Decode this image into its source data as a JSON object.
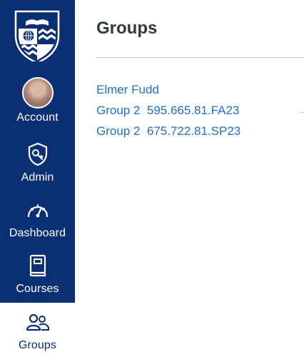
{
  "sidebar": {
    "items": [
      {
        "label": "Account",
        "icon": "avatar"
      },
      {
        "label": "Admin",
        "icon": "shield-key-icon"
      },
      {
        "label": "Dashboard",
        "icon": "speedometer-icon"
      },
      {
        "label": "Courses",
        "icon": "book-icon"
      },
      {
        "label": "Groups",
        "icon": "users-icon",
        "active": true
      }
    ]
  },
  "main": {
    "title": "Groups",
    "groups": [
      {
        "label": "Elmer Fudd"
      },
      {
        "label": "Group 2  595.665.81.FA23"
      },
      {
        "label": "Group 2  675.722.81.SP23"
      }
    ]
  },
  "colors": {
    "sidebar_bg": "#0b2f74",
    "link": "#1f6fcc",
    "title": "#2d3b45"
  }
}
